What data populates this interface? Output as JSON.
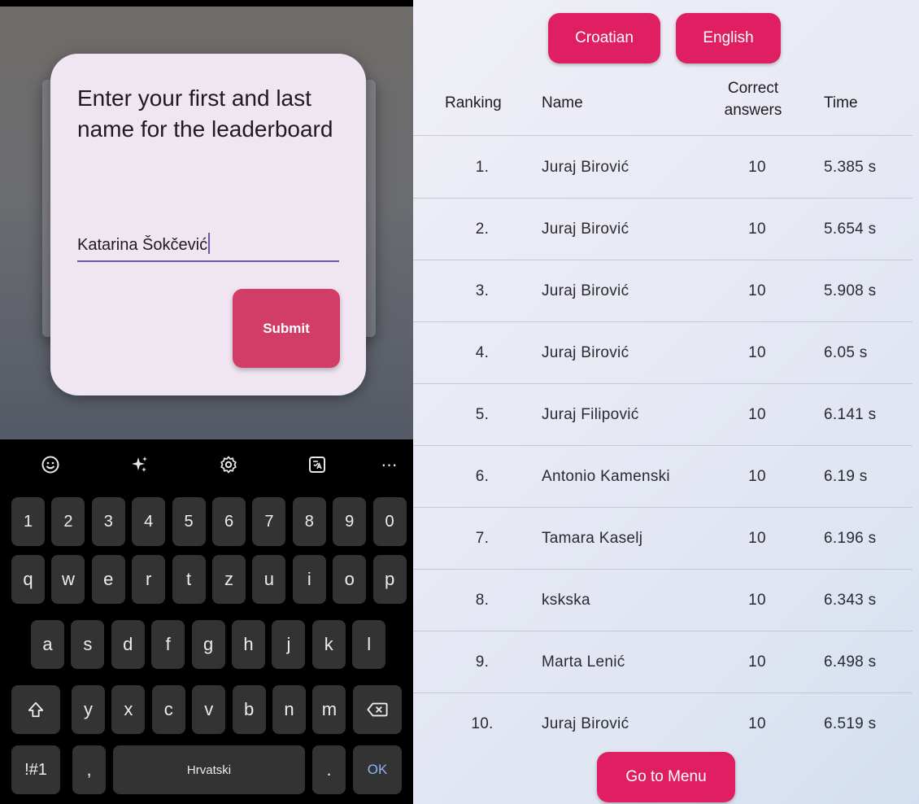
{
  "dialog": {
    "title": "Enter your first and last name for the leaderboard",
    "name_value": "Katarina Šokčević",
    "submit_label": "Submit"
  },
  "keyboard": {
    "toolbar_icons": [
      "emoji-icon",
      "sparkle-icon",
      "gear-icon",
      "translate-icon",
      "more-icon"
    ],
    "number_row": [
      "1",
      "2",
      "3",
      "4",
      "5",
      "6",
      "7",
      "8",
      "9",
      "0"
    ],
    "row1": [
      "q",
      "w",
      "e",
      "r",
      "t",
      "z",
      "u",
      "i",
      "o",
      "p"
    ],
    "row2": [
      "a",
      "s",
      "d",
      "f",
      "g",
      "h",
      "j",
      "k",
      "l"
    ],
    "row3": [
      "y",
      "x",
      "c",
      "v",
      "b",
      "n",
      "m"
    ],
    "symbols_label": "!#1",
    "comma_label": ",",
    "space_label": "Hrvatski",
    "period_label": ".",
    "ok_label": "OK"
  },
  "leaderboard": {
    "lang_buttons": {
      "croatian": "Croatian",
      "english": "English"
    },
    "headers": {
      "ranking": "Ranking",
      "name": "Name",
      "correct": "Correct answers",
      "time": "Time"
    },
    "rows": [
      {
        "rank": "1.",
        "name": "Juraj Birović",
        "correct": "10",
        "time": "5.385 s"
      },
      {
        "rank": "2.",
        "name": "Juraj Birović",
        "correct": "10",
        "time": "5.654 s"
      },
      {
        "rank": "3.",
        "name": "Juraj Birović",
        "correct": "10",
        "time": "5.908 s"
      },
      {
        "rank": "4.",
        "name": "Juraj Birović",
        "correct": "10",
        "time": "6.05 s"
      },
      {
        "rank": "5.",
        "name": "Juraj Filipović",
        "correct": "10",
        "time": "6.141 s"
      },
      {
        "rank": "6.",
        "name": "Antonio Kamenski",
        "correct": "10",
        "time": "6.19 s"
      },
      {
        "rank": "7.",
        "name": "Tamara Kaselj",
        "correct": "10",
        "time": "6.196 s"
      },
      {
        "rank": "8.",
        "name": "kskska",
        "correct": "10",
        "time": "6.343 s"
      },
      {
        "rank": "9.",
        "name": "Marta Lenić",
        "correct": "10",
        "time": "6.498 s"
      },
      {
        "rank": "10.",
        "name": "Juraj Birović",
        "correct": "10",
        "time": "6.519 s"
      }
    ],
    "menu_button": "Go to Menu"
  },
  "colors": {
    "accent_pink": "#e01f63",
    "submit_pink": "#d23d68",
    "input_underline": "#6e57a6",
    "dialog_bg": "#efe6f2",
    "key_bg": "#333334",
    "ok_blue": "#8ab4f8"
  }
}
